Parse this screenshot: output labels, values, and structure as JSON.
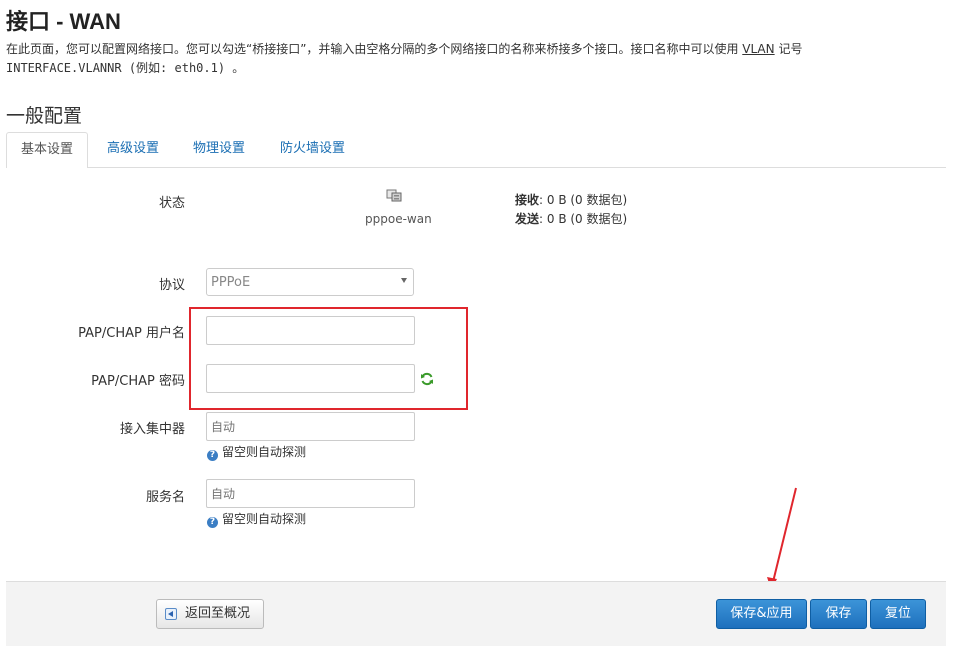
{
  "header": {
    "title": "接口 - WAN",
    "desc_part1": "在此页面，您可以配置网络接口。您可以勾选“桥接接口”，并输入由空格分隔的多个网络接口的名称来桥接多个接口。接口名称中可以使用 ",
    "desc_vlan": "VLAN",
    "desc_part2": " 记号",
    "desc_line2": "INTERFACE.VLANNR (例如: eth0.1) 。"
  },
  "section": {
    "title": "一般配置"
  },
  "tabs": [
    {
      "label": "基本设置"
    },
    {
      "label": "高级设置"
    },
    {
      "label": "物理设置"
    },
    {
      "label": "防火墙设置"
    }
  ],
  "status": {
    "label": "状态",
    "iface_name": "pppoe-wan",
    "rx_label": "接收",
    "rx_value": ": 0 B (0 数据包)",
    "tx_label": "发送",
    "tx_value": ": 0 B (0 数据包)"
  },
  "form": {
    "protocol_label": "协议",
    "protocol_value": "PPPoE",
    "username_label": "PAP/CHAP 用户名",
    "password_label": "PAP/CHAP 密码",
    "ac_label": "接入集中器",
    "ac_placeholder": "自动",
    "ac_hint": "留空则自动探测",
    "service_label": "服务名",
    "service_placeholder": "自动",
    "service_hint": "留空则自动探测"
  },
  "footer": {
    "back_label": "返回至概况",
    "save_apply_label": "保存&应用",
    "save_label": "保存",
    "reset_label": "复位"
  },
  "colors": {
    "primary": "#1e70bd",
    "link": "#1a6eb3",
    "highlight": "#e0262d"
  }
}
